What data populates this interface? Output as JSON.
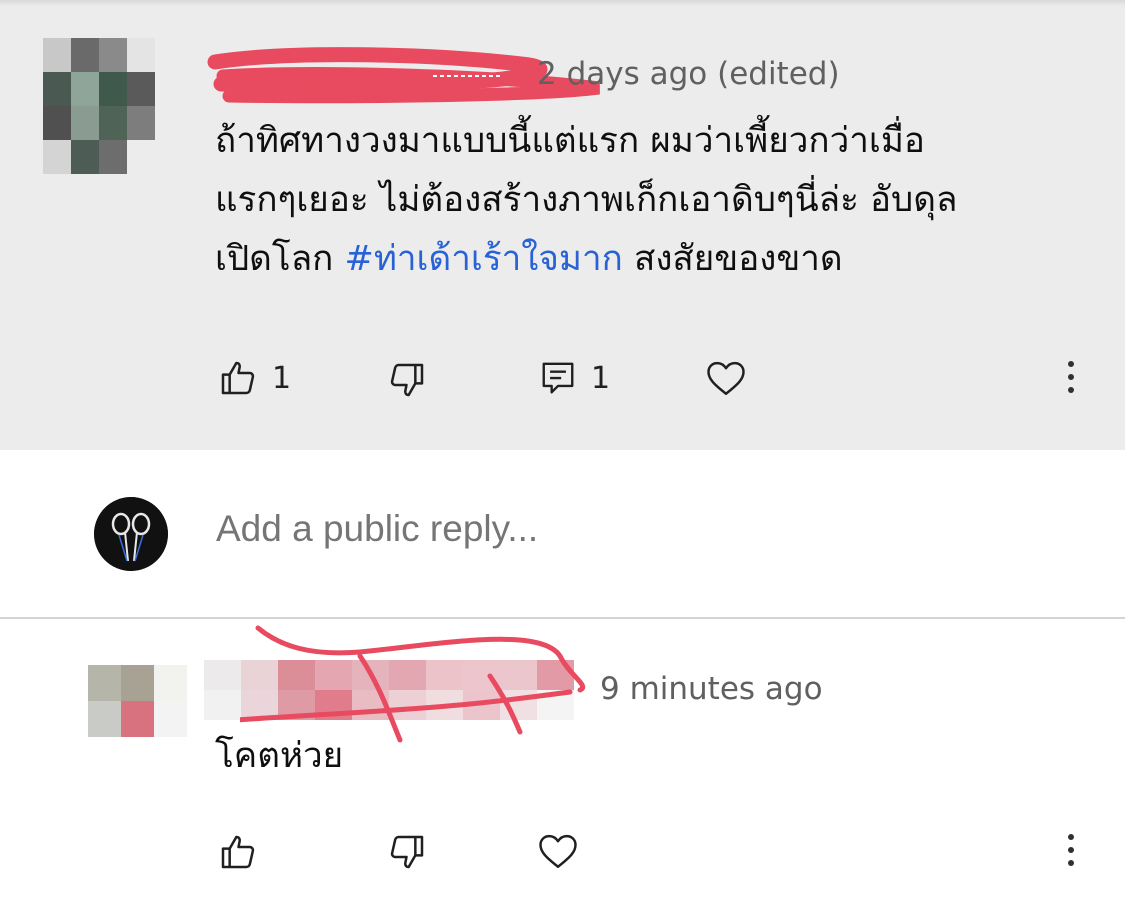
{
  "comments": [
    {
      "meta": "2 days ago (edited)",
      "text_plain_1": "ถ้าทิศทางวงมาแบบนี้แต่แรก ผมว่าเพี้ยวกว่าเมื่อ",
      "text_plain_2": "แรกๆเยอะ ไม่ต้องสร้างภาพเก็กเอาดิบๆนี่ล่ะ อับดุล",
      "text_plain_3": "เปิดโลก",
      "hashtag": "#ท่าเด้าเร้าใจมาก",
      "text_plain_4": "สงสัยของขาด",
      "likes": "1",
      "replies": "1",
      "author_redacted": true
    },
    {
      "meta": "9 minutes ago",
      "text": "โคตห่วย",
      "author_redacted": true
    }
  ],
  "reply_box": {
    "placeholder": "Add a public reply..."
  },
  "icons": {
    "like": "thumbs-up-icon",
    "dislike": "thumbs-down-icon",
    "reply": "comment-icon",
    "heart": "heart-icon",
    "more": "more-vertical-icon"
  },
  "colors": {
    "highlight_bg": "#ececec",
    "hashtag": "#2962d6",
    "redaction": "#e84a5f",
    "meta_text": "#606060"
  },
  "avatar_pixels_1": [
    "#c8c8c8",
    "#6a6a6a",
    "#8a8a8a",
    "#e4e4e4",
    "#4a5a52",
    "#8fa59a",
    "#3f5a4c",
    "#5a5a5a",
    "#505050",
    "#8a9c92",
    "#4f6357",
    "#7d7d7d",
    "#d4d4d4",
    "#4d5d55",
    "#6d6d6d",
    "#ececec"
  ],
  "avatar_pixels_3": [
    "#b6b5a9",
    "#a8a295",
    "#f2f2ee",
    "#c9ccc6",
    "#d7727e",
    "#f3f3f3"
  ],
  "name_pixels_3": [
    "#eceaea",
    "#e9d3d6",
    "#db8d98",
    "#e4a6b0",
    "#e4b3bb",
    "#e3a7b1",
    "#ebc3c9",
    "#ecc6cc",
    "#ebc6cc",
    "#e19aa6",
    "#f2f1f1",
    "#ead6da",
    "#de9ba6",
    "#e07c8c",
    "#e9bcc3",
    "#ecd0d5",
    "#f0dde0",
    "#ebc5cb",
    "#f1e0e3",
    "#f4f4f4"
  ]
}
